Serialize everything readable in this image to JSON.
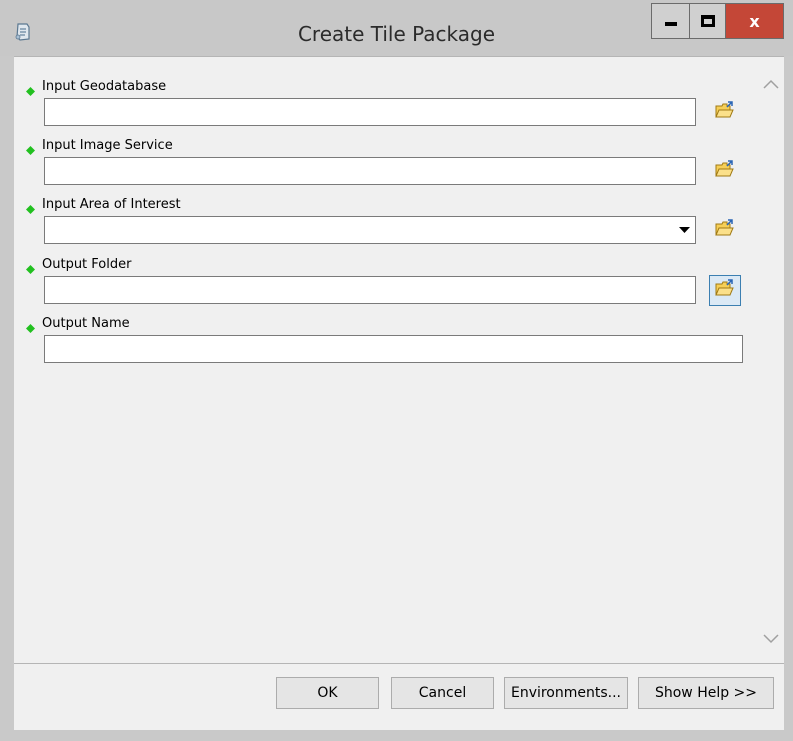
{
  "window": {
    "title": "Create Tile Package",
    "app_icon": "scroll-toolbox-icon",
    "controls": {
      "minimize": "minimize-icon",
      "maximize": "maximize-icon",
      "close_label": "x"
    }
  },
  "parameters": [
    {
      "label": "Input Geodatabase",
      "value": "",
      "type": "text",
      "browse": true,
      "required": true
    },
    {
      "label": "Input Image Service",
      "value": "",
      "type": "text",
      "browse": true,
      "required": true
    },
    {
      "label": "Input Area of Interest",
      "value": "",
      "type": "combo",
      "browse": true,
      "required": true
    },
    {
      "label": "Output Folder",
      "value": "",
      "type": "text",
      "browse": true,
      "required": true,
      "browse_active": true
    },
    {
      "label": "Output Name",
      "value": "",
      "type": "text",
      "browse": false,
      "required": true
    }
  ],
  "buttons": {
    "ok": "OK",
    "cancel": "Cancel",
    "environments": "Environments...",
    "show_help": "Show Help >>"
  },
  "colors": {
    "required_dot": "#22c020",
    "close_button": "#c44737",
    "dialog_bg": "#f0f0f0"
  }
}
